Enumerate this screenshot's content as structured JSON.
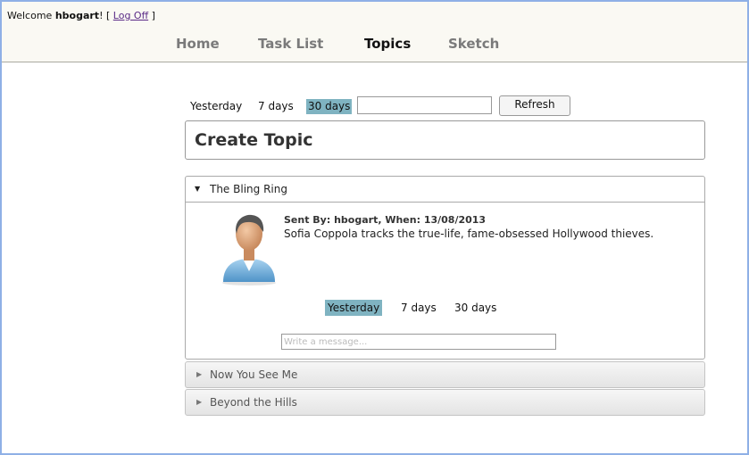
{
  "header": {
    "welcome_prefix": "Welcome",
    "username": "hbogart",
    "welcome_suffix": "! [",
    "logoff_label": "Log Off",
    "bracket_close": "]"
  },
  "nav": {
    "items": [
      {
        "label": "Home",
        "active": false
      },
      {
        "label": "Task List",
        "active": false
      },
      {
        "label": "Topics",
        "active": true
      },
      {
        "label": "Sketch",
        "active": false
      }
    ]
  },
  "filters": {
    "options": [
      "Yesterday",
      "7 days",
      "30 days"
    ],
    "selected": "30 days",
    "search_value": "",
    "refresh_label": "Refresh"
  },
  "create_topic": {
    "title": "Create Topic"
  },
  "topics": [
    {
      "title": "The Bling Ring",
      "expanded": true,
      "sent_by_line": "Sent By: hbogart, When: 13/08/2013",
      "message": "Sofia Coppola tracks the true-life, fame-obsessed Hollywood thieves.",
      "filters": [
        "Yesterday",
        "7 days",
        "30 days"
      ],
      "selected_filter": "Yesterday",
      "write_placeholder": "Write a message..."
    },
    {
      "title": "Now You See Me",
      "expanded": false
    },
    {
      "title": "Beyond the Hills",
      "expanded": false
    }
  ],
  "colors": {
    "selected_filter_bg": "#7fb3c1",
    "frame_border": "#8fb0e6",
    "header_bg": "#faf9f3"
  }
}
